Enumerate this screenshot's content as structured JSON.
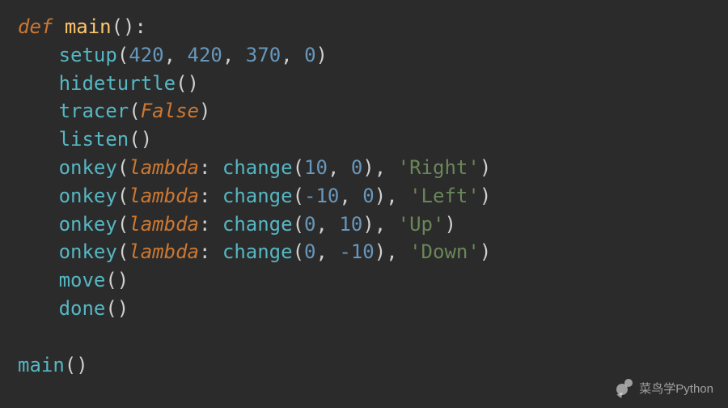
{
  "code": {
    "def": "def",
    "main_name": "main",
    "setup": "setup",
    "setup_args": [
      "420",
      "420",
      "370",
      "0"
    ],
    "hideturtle": "hideturtle",
    "tracer": "tracer",
    "false": "False",
    "listen": "listen",
    "onkey": "onkey",
    "lambda": "lambda",
    "change": "change",
    "onkey_lines": [
      {
        "args": [
          "10",
          "0"
        ],
        "key": "'Right'"
      },
      {
        "args": [
          "-10",
          "0"
        ],
        "key": "'Left'"
      },
      {
        "args": [
          "0",
          "10"
        ],
        "key": "'Up'"
      },
      {
        "args": [
          "0",
          "-10"
        ],
        "key": "'Down'"
      }
    ],
    "move": "move",
    "done": "done",
    "main_call": "main"
  },
  "watermark": {
    "text": "菜鸟学Python"
  }
}
